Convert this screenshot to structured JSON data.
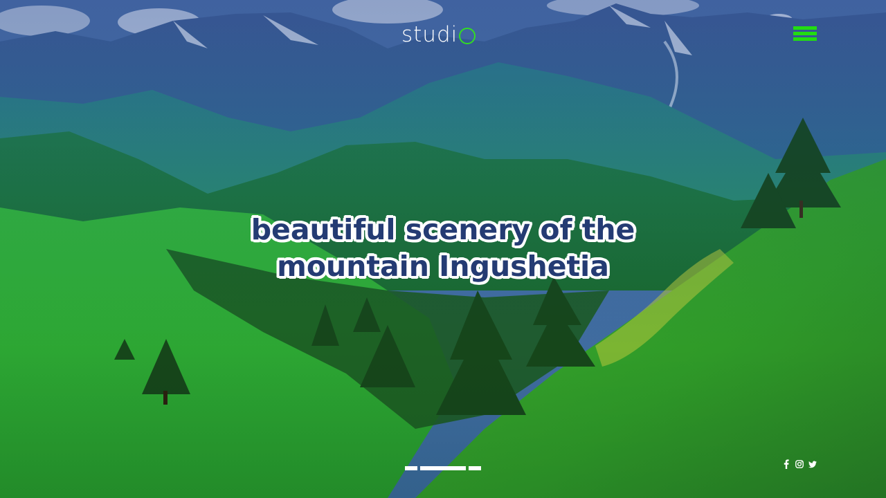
{
  "brand": {
    "logo_text": "studi",
    "accent_color": "#33dd22"
  },
  "header": {
    "menu_icon": "hamburger-menu-icon"
  },
  "hero": {
    "headline": "beautiful scenery of the mountain Ingushetia",
    "headline_color": "#243b73",
    "background": "mountain-landscape-image"
  },
  "slider": {
    "dots": [
      {
        "label": "",
        "active": false
      },
      {
        "label": "",
        "active": true
      },
      {
        "label": "",
        "active": false
      }
    ]
  },
  "social": {
    "icons": [
      "facebook-icon",
      "instagram-icon",
      "twitter-icon"
    ]
  }
}
